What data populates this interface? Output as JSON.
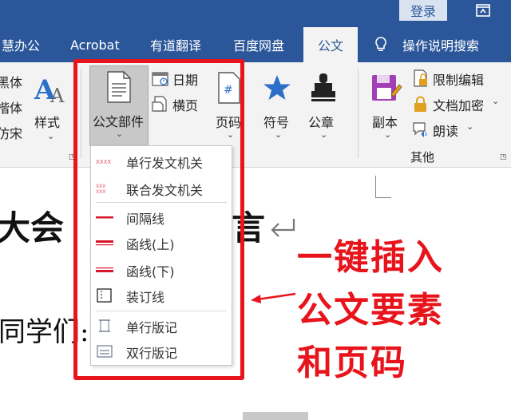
{
  "window": {
    "login_label": "登录",
    "restore_icon": "restore-window-icon"
  },
  "tabs": [
    {
      "label": "慧办公"
    },
    {
      "label": "Acrobat"
    },
    {
      "label": "有道翻译"
    },
    {
      "label": "百度网盘"
    },
    {
      "label": "公文",
      "active": true
    },
    {
      "label": "操作说明搜索"
    }
  ],
  "ribbon": {
    "font_list": [
      "黑体",
      "楷体",
      "仿宋"
    ],
    "style_label": "样式",
    "parts_label": "公文部件",
    "date_label": "日期",
    "landscape_label": "横页",
    "page_number_label": "页码",
    "symbol_label": "符号",
    "seal_label": "公章",
    "copy_label": "副本",
    "restrict_edit_label": "限制编辑",
    "encrypt_label": "文档加密",
    "read_label": "朗读",
    "group_other_label": "其他",
    "accent_color": "#2b579a",
    "star_color": "#2b6fc8",
    "lock_color": "#e0a020"
  },
  "dropdown": {
    "items": [
      {
        "label": "单行发文机关",
        "icon": "single-issuer-icon"
      },
      {
        "label": "联合发文机关",
        "icon": "joint-issuer-icon"
      },
      {
        "label": "间隔线",
        "icon": "spacer-line-icon"
      },
      {
        "label": "函线(上)",
        "icon": "letter-line-top-icon"
      },
      {
        "label": "函线(下)",
        "icon": "letter-line-bottom-icon"
      },
      {
        "label": "装订线",
        "icon": "binding-line-icon"
      },
      {
        "label": "单行版记",
        "icon": "single-colophon-icon"
      },
      {
        "label": "双行版记",
        "icon": "double-colophon-icon"
      }
    ]
  },
  "document": {
    "line1_left": "大会",
    "line1_right": "言",
    "line2": "同学们:"
  },
  "annotation": {
    "lines": [
      "一键插入",
      "公文要素",
      "和页码"
    ],
    "color": "#e8141c"
  }
}
